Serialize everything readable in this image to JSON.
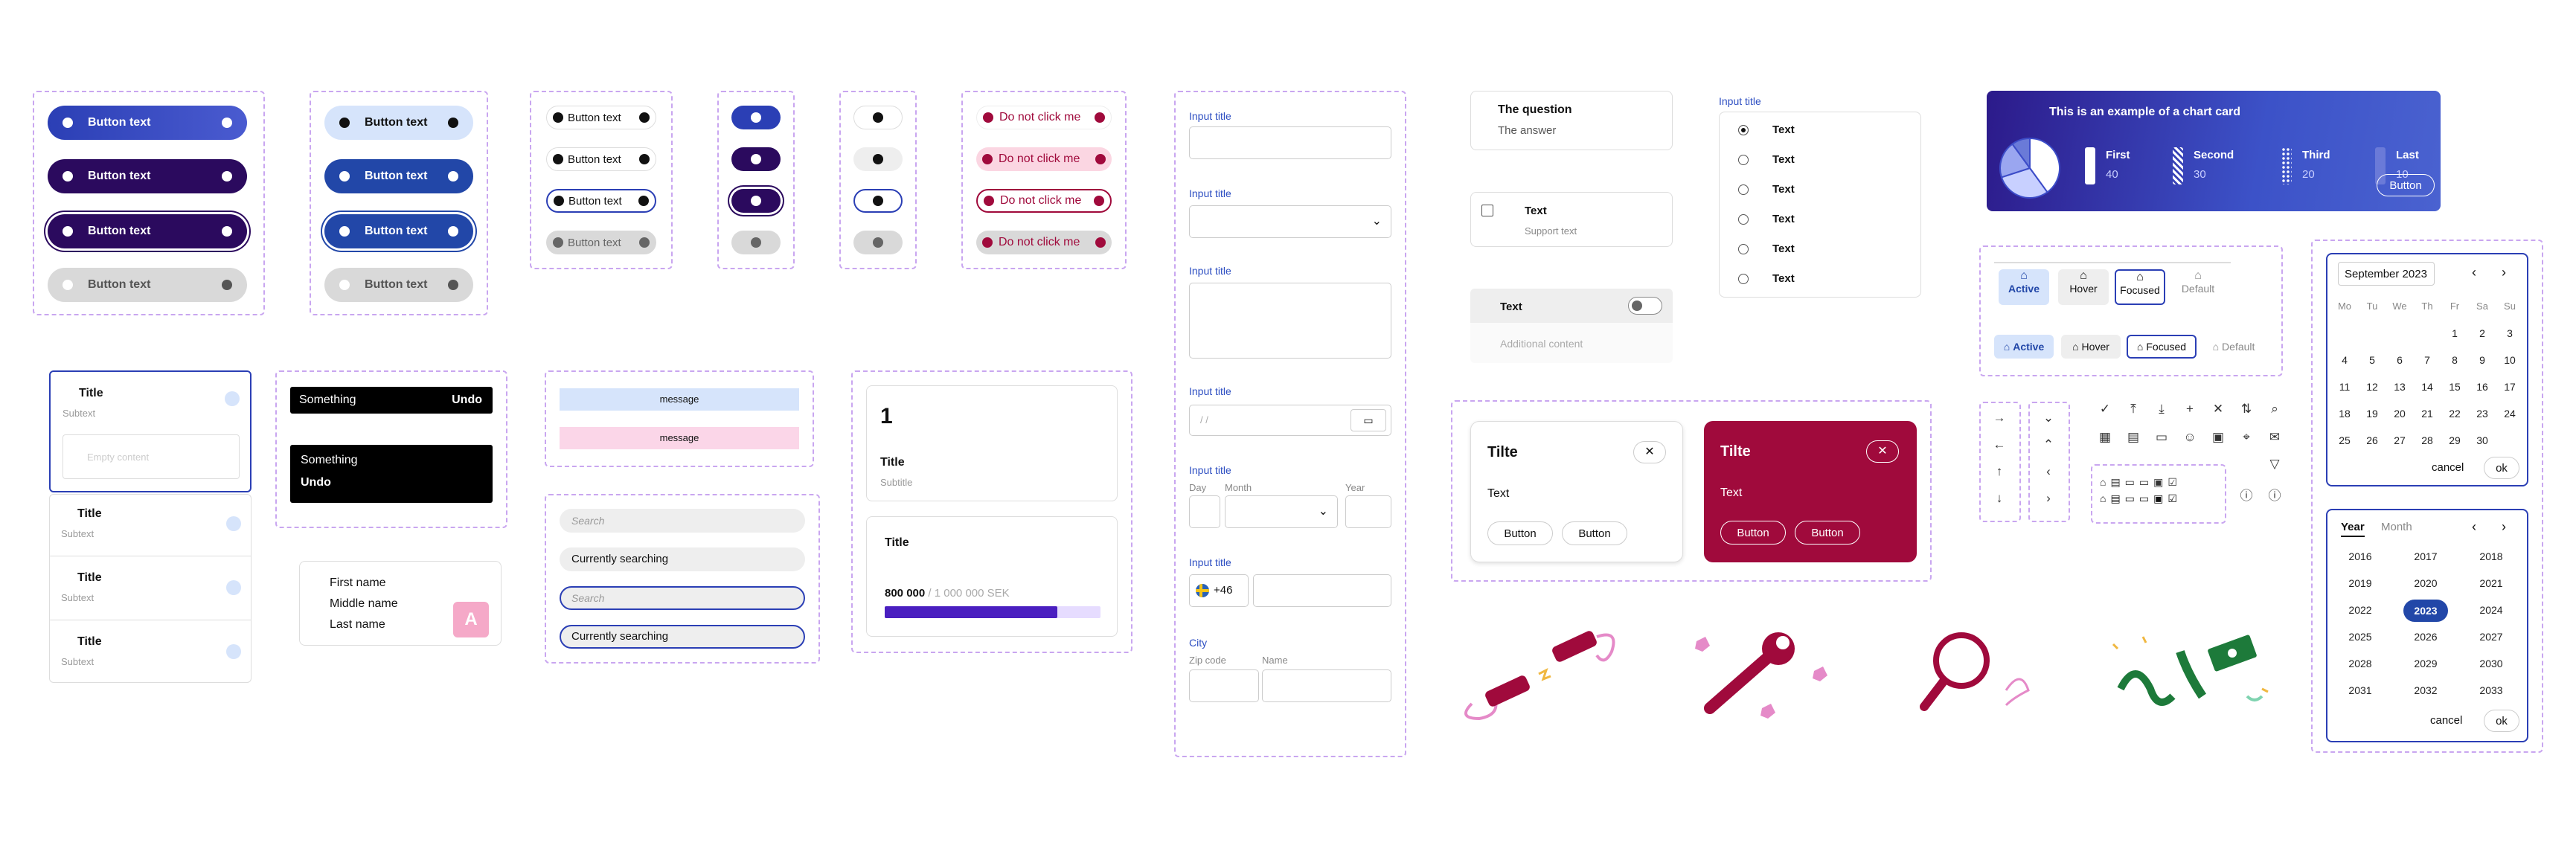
{
  "buttons": {
    "label": "Button text",
    "danger_label": "Do not click me"
  },
  "inputs": {
    "input_title": "Input title",
    "date_placeholder": "/   /",
    "date_labels": {
      "day": "Day",
      "month": "Month",
      "year": "Year"
    },
    "phone_code": "+46",
    "city_label": "City",
    "zip_label": "Zip code",
    "name_label": "Name"
  },
  "accordion": {
    "question": "The question",
    "answer": "The answer"
  },
  "checkbox_item": {
    "text": "Text",
    "support": "Support text"
  },
  "toggle_item": {
    "text": "Text",
    "additional": "Additional content"
  },
  "radio_group": {
    "title": "Input title",
    "options": [
      "Text",
      "Text",
      "Text",
      "Text",
      "Text",
      "Text"
    ]
  },
  "chart_card": {
    "title": "This is an example of a chart card",
    "button": "Button",
    "legend": [
      {
        "name": "First",
        "value": "40"
      },
      {
        "name": "Second",
        "value": "30"
      },
      {
        "name": "Third",
        "value": "20"
      },
      {
        "name": "Last",
        "value": "10"
      }
    ]
  },
  "chart_data": {
    "type": "pie",
    "title": "This is an example of a chart card",
    "categories": [
      "First",
      "Second",
      "Third",
      "Last"
    ],
    "values": [
      40,
      30,
      20,
      10
    ]
  },
  "nav_states": {
    "active": "Active",
    "hover": "Hover",
    "focused": "Focused",
    "default": "Default"
  },
  "list": {
    "title": "Title",
    "subtext": "Subtext",
    "empty": "Empty content"
  },
  "snackbar": {
    "text": "Something",
    "action": "Undo"
  },
  "names": {
    "first": "First name",
    "middle": "Middle name",
    "last": "Last name",
    "avatar": "A"
  },
  "messages": {
    "one": "message",
    "two": "message"
  },
  "search": {
    "placeholder": "Search",
    "active": "Currently searching"
  },
  "stat_card": {
    "number": "1",
    "title": "Title",
    "subtitle": "Subtitle"
  },
  "progress_card": {
    "title": "Title",
    "value": "800 000",
    "total": " / 1 000 000 SEK",
    "progress": 0.8
  },
  "modal": {
    "title": "Tilte",
    "body": "Text",
    "button": "Button"
  },
  "calendar": {
    "month": "September 2023",
    "weekdays": [
      "Mo",
      "Tu",
      "We",
      "Th",
      "Fr",
      "Sa",
      "Su"
    ],
    "weeks": [
      [
        "",
        "",
        "",
        "",
        "1",
        "2",
        "3"
      ],
      [
        "4",
        "5",
        "6",
        "7",
        "8",
        "9",
        "10"
      ],
      [
        "11",
        "12",
        "13",
        "14",
        "15",
        "16",
        "17"
      ],
      [
        "18",
        "19",
        "20",
        "21",
        "22",
        "23",
        "24"
      ],
      [
        "25",
        "26",
        "27",
        "28",
        "29",
        "30",
        ""
      ]
    ],
    "cancel": "cancel",
    "ok": "ok"
  },
  "year_picker": {
    "tab_year": "Year",
    "tab_month": "Month",
    "years": [
      "2016",
      "2017",
      "2018",
      "2019",
      "2020",
      "2021",
      "2022",
      "2023",
      "2024",
      "2025",
      "2026",
      "2027",
      "2028",
      "2029",
      "2030",
      "2031",
      "2032",
      "2033"
    ],
    "selected": "2023",
    "cancel": "cancel",
    "ok": "ok"
  },
  "icons": [
    "check-icon",
    "upload-icon",
    "download-icon",
    "plus-icon",
    "close-icon",
    "sort-icon",
    "search-icon",
    "calendar-icon",
    "document-icon",
    "ticket-icon",
    "person-icon",
    "briefcase-icon",
    "location-icon",
    "mail-icon",
    "filter-icon",
    "info-icon",
    "phone-icon"
  ],
  "colors": {
    "primary": "#3b4cca",
    "dark": "#2b0a5e",
    "crimson": "#a00a3c",
    "dashed": "#c9a6f0"
  }
}
